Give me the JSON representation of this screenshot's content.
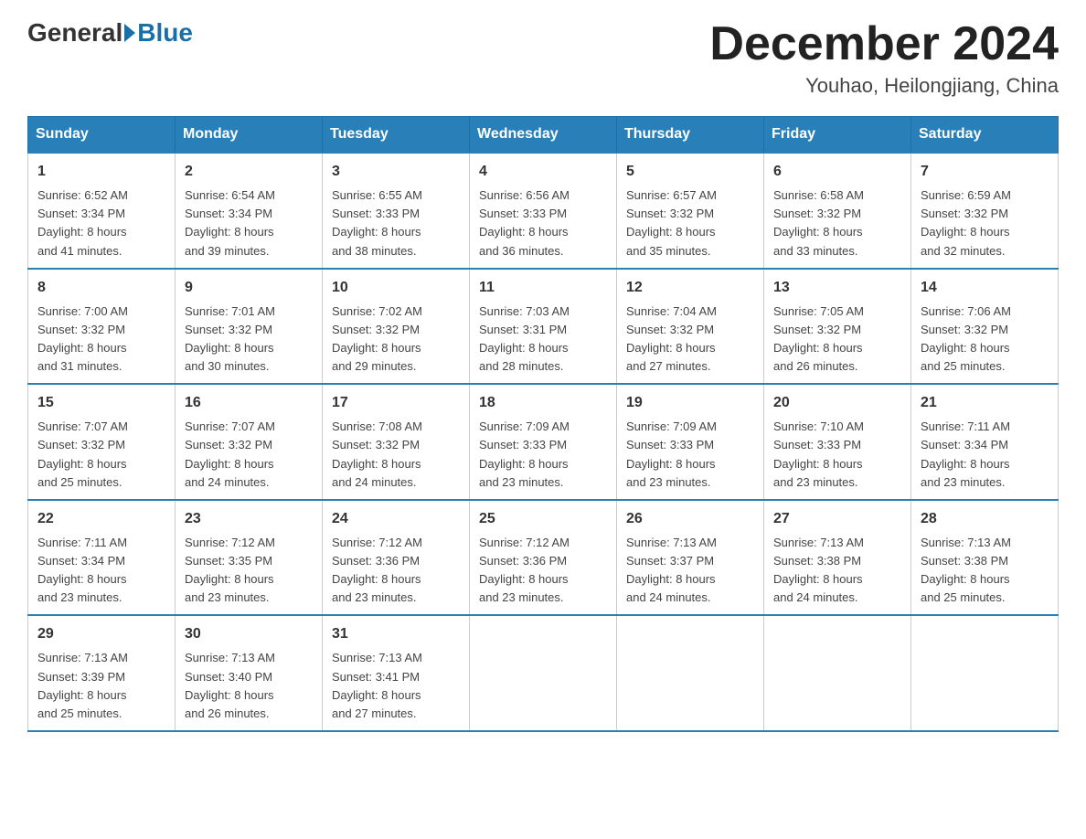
{
  "header": {
    "logo_general": "General",
    "logo_blue": "Blue",
    "title": "December 2024",
    "subtitle": "Youhao, Heilongjiang, China"
  },
  "weekdays": [
    "Sunday",
    "Monday",
    "Tuesday",
    "Wednesday",
    "Thursday",
    "Friday",
    "Saturday"
  ],
  "weeks": [
    [
      {
        "day": "1",
        "sunrise": "6:52 AM",
        "sunset": "3:34 PM",
        "daylight": "8 hours and 41 minutes."
      },
      {
        "day": "2",
        "sunrise": "6:54 AM",
        "sunset": "3:34 PM",
        "daylight": "8 hours and 39 minutes."
      },
      {
        "day": "3",
        "sunrise": "6:55 AM",
        "sunset": "3:33 PM",
        "daylight": "8 hours and 38 minutes."
      },
      {
        "day": "4",
        "sunrise": "6:56 AM",
        "sunset": "3:33 PM",
        "daylight": "8 hours and 36 minutes."
      },
      {
        "day": "5",
        "sunrise": "6:57 AM",
        "sunset": "3:32 PM",
        "daylight": "8 hours and 35 minutes."
      },
      {
        "day": "6",
        "sunrise": "6:58 AM",
        "sunset": "3:32 PM",
        "daylight": "8 hours and 33 minutes."
      },
      {
        "day": "7",
        "sunrise": "6:59 AM",
        "sunset": "3:32 PM",
        "daylight": "8 hours and 32 minutes."
      }
    ],
    [
      {
        "day": "8",
        "sunrise": "7:00 AM",
        "sunset": "3:32 PM",
        "daylight": "8 hours and 31 minutes."
      },
      {
        "day": "9",
        "sunrise": "7:01 AM",
        "sunset": "3:32 PM",
        "daylight": "8 hours and 30 minutes."
      },
      {
        "day": "10",
        "sunrise": "7:02 AM",
        "sunset": "3:32 PM",
        "daylight": "8 hours and 29 minutes."
      },
      {
        "day": "11",
        "sunrise": "7:03 AM",
        "sunset": "3:31 PM",
        "daylight": "8 hours and 28 minutes."
      },
      {
        "day": "12",
        "sunrise": "7:04 AM",
        "sunset": "3:32 PM",
        "daylight": "8 hours and 27 minutes."
      },
      {
        "day": "13",
        "sunrise": "7:05 AM",
        "sunset": "3:32 PM",
        "daylight": "8 hours and 26 minutes."
      },
      {
        "day": "14",
        "sunrise": "7:06 AM",
        "sunset": "3:32 PM",
        "daylight": "8 hours and 25 minutes."
      }
    ],
    [
      {
        "day": "15",
        "sunrise": "7:07 AM",
        "sunset": "3:32 PM",
        "daylight": "8 hours and 25 minutes."
      },
      {
        "day": "16",
        "sunrise": "7:07 AM",
        "sunset": "3:32 PM",
        "daylight": "8 hours and 24 minutes."
      },
      {
        "day": "17",
        "sunrise": "7:08 AM",
        "sunset": "3:32 PM",
        "daylight": "8 hours and 24 minutes."
      },
      {
        "day": "18",
        "sunrise": "7:09 AM",
        "sunset": "3:33 PM",
        "daylight": "8 hours and 23 minutes."
      },
      {
        "day": "19",
        "sunrise": "7:09 AM",
        "sunset": "3:33 PM",
        "daylight": "8 hours and 23 minutes."
      },
      {
        "day": "20",
        "sunrise": "7:10 AM",
        "sunset": "3:33 PM",
        "daylight": "8 hours and 23 minutes."
      },
      {
        "day": "21",
        "sunrise": "7:11 AM",
        "sunset": "3:34 PM",
        "daylight": "8 hours and 23 minutes."
      }
    ],
    [
      {
        "day": "22",
        "sunrise": "7:11 AM",
        "sunset": "3:34 PM",
        "daylight": "8 hours and 23 minutes."
      },
      {
        "day": "23",
        "sunrise": "7:12 AM",
        "sunset": "3:35 PM",
        "daylight": "8 hours and 23 minutes."
      },
      {
        "day": "24",
        "sunrise": "7:12 AM",
        "sunset": "3:36 PM",
        "daylight": "8 hours and 23 minutes."
      },
      {
        "day": "25",
        "sunrise": "7:12 AM",
        "sunset": "3:36 PM",
        "daylight": "8 hours and 23 minutes."
      },
      {
        "day": "26",
        "sunrise": "7:13 AM",
        "sunset": "3:37 PM",
        "daylight": "8 hours and 24 minutes."
      },
      {
        "day": "27",
        "sunrise": "7:13 AM",
        "sunset": "3:38 PM",
        "daylight": "8 hours and 24 minutes."
      },
      {
        "day": "28",
        "sunrise": "7:13 AM",
        "sunset": "3:38 PM",
        "daylight": "8 hours and 25 minutes."
      }
    ],
    [
      {
        "day": "29",
        "sunrise": "7:13 AM",
        "sunset": "3:39 PM",
        "daylight": "8 hours and 25 minutes."
      },
      {
        "day": "30",
        "sunrise": "7:13 AM",
        "sunset": "3:40 PM",
        "daylight": "8 hours and 26 minutes."
      },
      {
        "day": "31",
        "sunrise": "7:13 AM",
        "sunset": "3:41 PM",
        "daylight": "8 hours and 27 minutes."
      },
      null,
      null,
      null,
      null
    ]
  ],
  "labels": {
    "sunrise": "Sunrise:",
    "sunset": "Sunset:",
    "daylight": "Daylight:"
  }
}
